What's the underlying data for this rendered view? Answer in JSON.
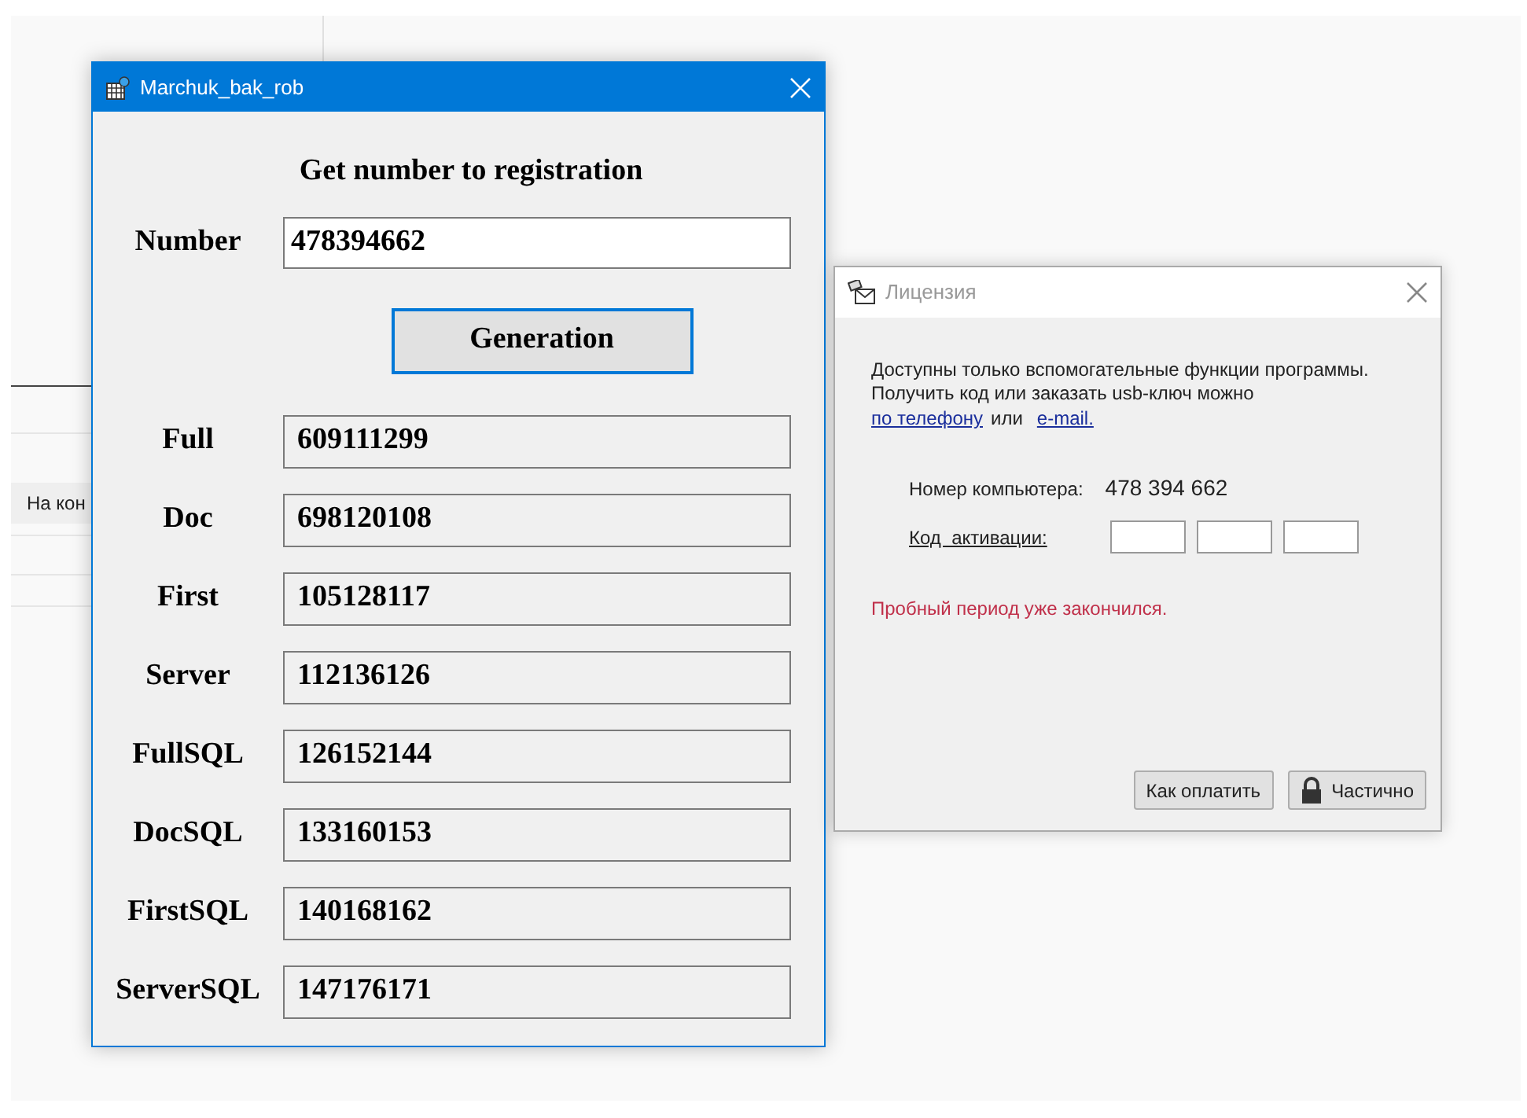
{
  "background": {
    "row_text": "На кон"
  },
  "main_window": {
    "title": "Marchuk_bak_rob",
    "heading": "Get number to registration",
    "number_label": "Number",
    "number_value": "478394662",
    "generate_button": "Generation",
    "codes": [
      {
        "label": "Full",
        "value": "609111299"
      },
      {
        "label": "Doc",
        "value": "698120108"
      },
      {
        "label": "First",
        "value": "105128117"
      },
      {
        "label": "Server",
        "value": "112136126"
      },
      {
        "label": "FullSQL",
        "value": "126152144"
      },
      {
        "label": "DocSQL",
        "value": "133160153"
      },
      {
        "label": "FirstSQL",
        "value": "140168162"
      },
      {
        "label": "ServerSQL",
        "value": "147176171"
      }
    ]
  },
  "license_window": {
    "title": "Лицензия",
    "message_lines": [
      "Доступны только вспомогательные функции программы.",
      "Получить код или заказать usb-ключ можно"
    ],
    "phone_link": "по телефону",
    "or_text": "или",
    "email_link": "e-mail.",
    "computer_number_label": "Номер компьютера:",
    "computer_number": "478 394 662",
    "activation_label": "Код  активации:",
    "activation_fields": [
      {
        "kind": "input"
      },
      {
        "kind": "input"
      },
      {
        "kind": "input"
      }
    ],
    "trial_message": "Пробный период уже закончился.",
    "buttons": [
      {
        "label": "Как оплатить",
        "kind": "plain"
      },
      {
        "label": "Частично",
        "kind": "lock"
      }
    ]
  }
}
